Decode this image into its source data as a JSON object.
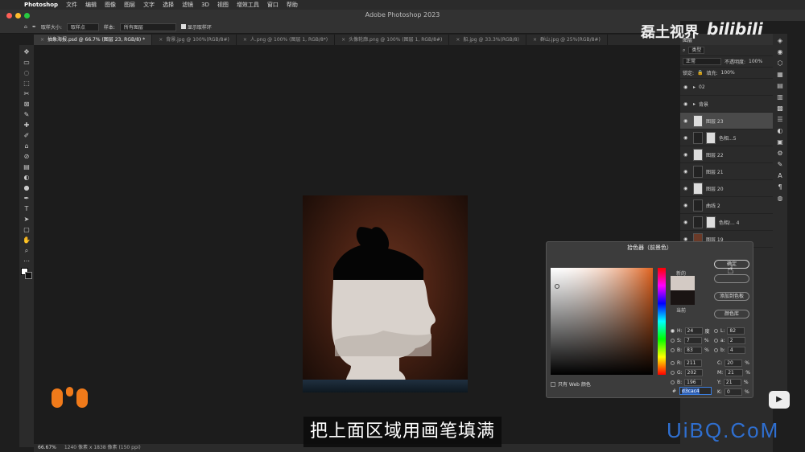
{
  "menubar": {
    "app": "Photoshop",
    "items": [
      "文件",
      "编辑",
      "图像",
      "图层",
      "文字",
      "选择",
      "滤镜",
      "3D",
      "视图",
      "增效工具",
      "窗口",
      "帮助"
    ]
  },
  "window": {
    "title": "Adobe Photoshop 2023"
  },
  "options": {
    "sample_size_label": "取样大小:",
    "sample_size_value": "取样点",
    "sample_label": "样本:",
    "sample_value": "所有图层",
    "ring_label": "显示取样环"
  },
  "tabs": [
    "抽象海报.psd @ 66.7% (图层 23, RGB/8) *",
    "背景.jpg @ 100%(RGB/8#)",
    "人.png @ 100% (图层 1, RGB/8*)",
    "头像轮廓.png @ 100% (图层 1, RGB/8#)",
    "船.jpg @ 33.3%(RGB/8)",
    "群山.jpg @ 25%(RGB/8#)"
  ],
  "toolbar": {
    "glyphs": [
      "✥",
      "▭",
      "◌",
      "⬚",
      "✂",
      "⊠",
      "✎",
      "✚",
      "✐",
      "⌂",
      "⊘",
      "▤",
      "◐",
      "●",
      "✒",
      "T",
      "➤",
      "▢",
      "✋",
      "⌕",
      "⋯"
    ]
  },
  "status": {
    "zoom": "66.67%",
    "info": "1240 像素 x 1838 像素 (150 ppi)"
  },
  "layers_panel": {
    "tab": "图层",
    "kind": "类型",
    "blend": "正常",
    "opacity_label": "不透明度:",
    "opacity": "100%",
    "lock_label": "锁定:",
    "fill_label": "填充:",
    "fill": "100%",
    "layers": [
      {
        "name": "02"
      },
      {
        "name": "背景"
      },
      {
        "name": "图层 23"
      },
      {
        "name": "色相...5"
      },
      {
        "name": "图层 22"
      },
      {
        "name": "图层 21"
      },
      {
        "name": "图层 20"
      },
      {
        "name": "曲线 2"
      },
      {
        "name": "色相/... 4"
      },
      {
        "name": "图层 19"
      }
    ]
  },
  "color_picker": {
    "title": "拾色器（前景色）",
    "new_label": "新的",
    "current_label": "当前",
    "ok": "确定",
    "add_swatch": "添加到色板",
    "color_library": "颜色库",
    "web_only": "只有 Web 颜色",
    "hex_label": "#",
    "hex": "d3cac4",
    "h": {
      "label": "H:",
      "value": "24",
      "unit": "度"
    },
    "s": {
      "label": "S:",
      "value": "7",
      "unit": "%"
    },
    "b": {
      "label": "B:",
      "value": "83",
      "unit": "%"
    },
    "r": {
      "label": "R:",
      "value": "211"
    },
    "g": {
      "label": "G:",
      "value": "202"
    },
    "bb": {
      "label": "B:",
      "value": "196"
    },
    "l": {
      "label": "L:",
      "value": "82"
    },
    "a": {
      "label": "a:",
      "value": "2"
    },
    "blab": {
      "label": "b:",
      "value": "4"
    },
    "c": {
      "label": "C:",
      "value": "20",
      "unit": "%"
    },
    "m": {
      "label": "M:",
      "value": "21",
      "unit": "%"
    },
    "y": {
      "label": "Y:",
      "value": "21",
      "unit": "%"
    },
    "k": {
      "label": "K:",
      "value": "0",
      "unit": "%"
    }
  },
  "subtitle": "把上面区域用画笔填满",
  "watermarks": {
    "channel": "磊土视界",
    "site": "bilibili",
    "brand": "UiBQ.CoM"
  }
}
